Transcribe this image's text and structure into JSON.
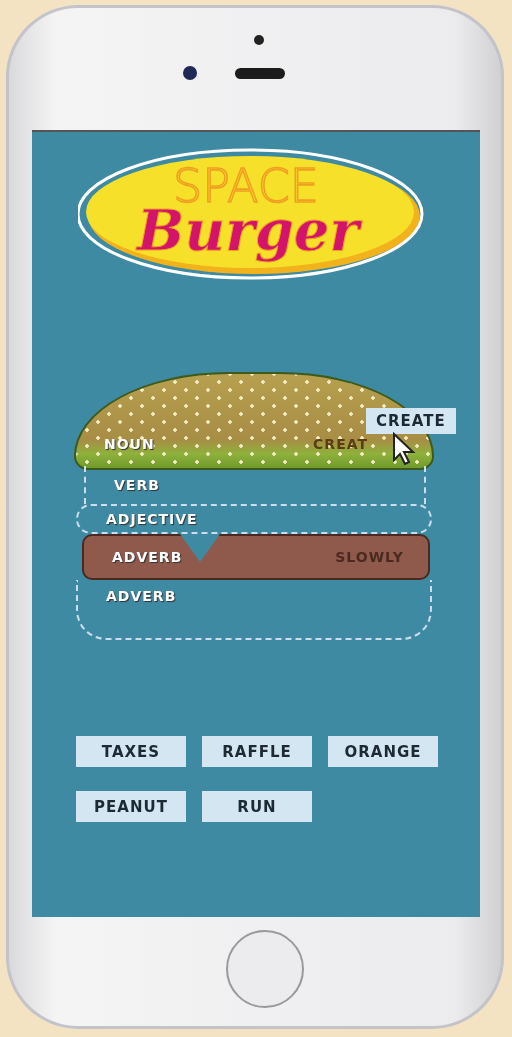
{
  "logo": {
    "top_word": "SPACE",
    "bottom_word": "Burger"
  },
  "burger_layers": [
    {
      "kind": "bun",
      "label": "NOUN",
      "word": "CREAT"
    },
    {
      "kind": "slot",
      "label": "VERB"
    },
    {
      "kind": "wavy",
      "label": "ADJECTIVE"
    },
    {
      "kind": "patty",
      "label": "ADVERB",
      "word": "SLOWLY"
    },
    {
      "kind": "bottom",
      "label": "ADVERB"
    }
  ],
  "dragged_tile": "CREATE",
  "word_tiles": [
    "TAXES",
    "RAFFLE",
    "ORANGE",
    "PEANUT",
    "RUN"
  ]
}
